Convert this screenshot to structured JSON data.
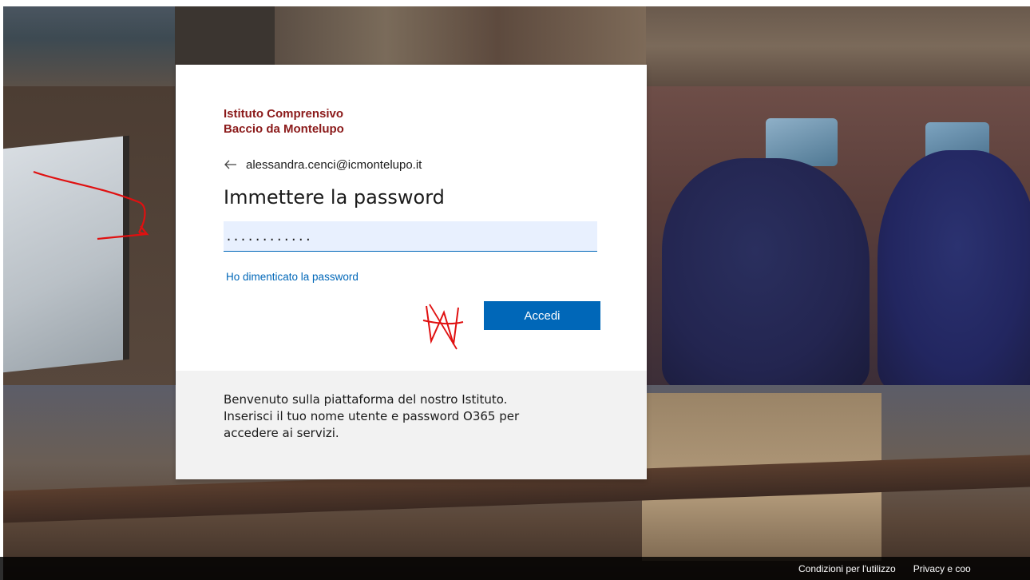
{
  "background": {
    "description_icon": "school-photo-collage"
  },
  "signin": {
    "organization": {
      "line1": "Istituto Comprensivo",
      "line2": "Baccio da Montelupo"
    },
    "identity": {
      "back_icon": "arrow-left-icon",
      "email": "alessandra.cenci@icmontelupo.it"
    },
    "heading": "Immettere la password",
    "password_field": {
      "value": "............"
    },
    "forgot_link": "Ho dimenticato la password",
    "submit_label": "Accedi",
    "welcome": {
      "line1": "Benvenuto sulla piattaforma del nostro Istituto.",
      "line2": "Inserisci il tuo nome utente e password O365 per",
      "line3": "accedere ai servizi."
    }
  },
  "footer": {
    "terms": "Condizioni per l'utilizzo",
    "privacy": "Privacy e coo"
  },
  "colors": {
    "accent": "#0067b8",
    "org_name": "#8b1a1a",
    "annotation": "#e01010"
  }
}
